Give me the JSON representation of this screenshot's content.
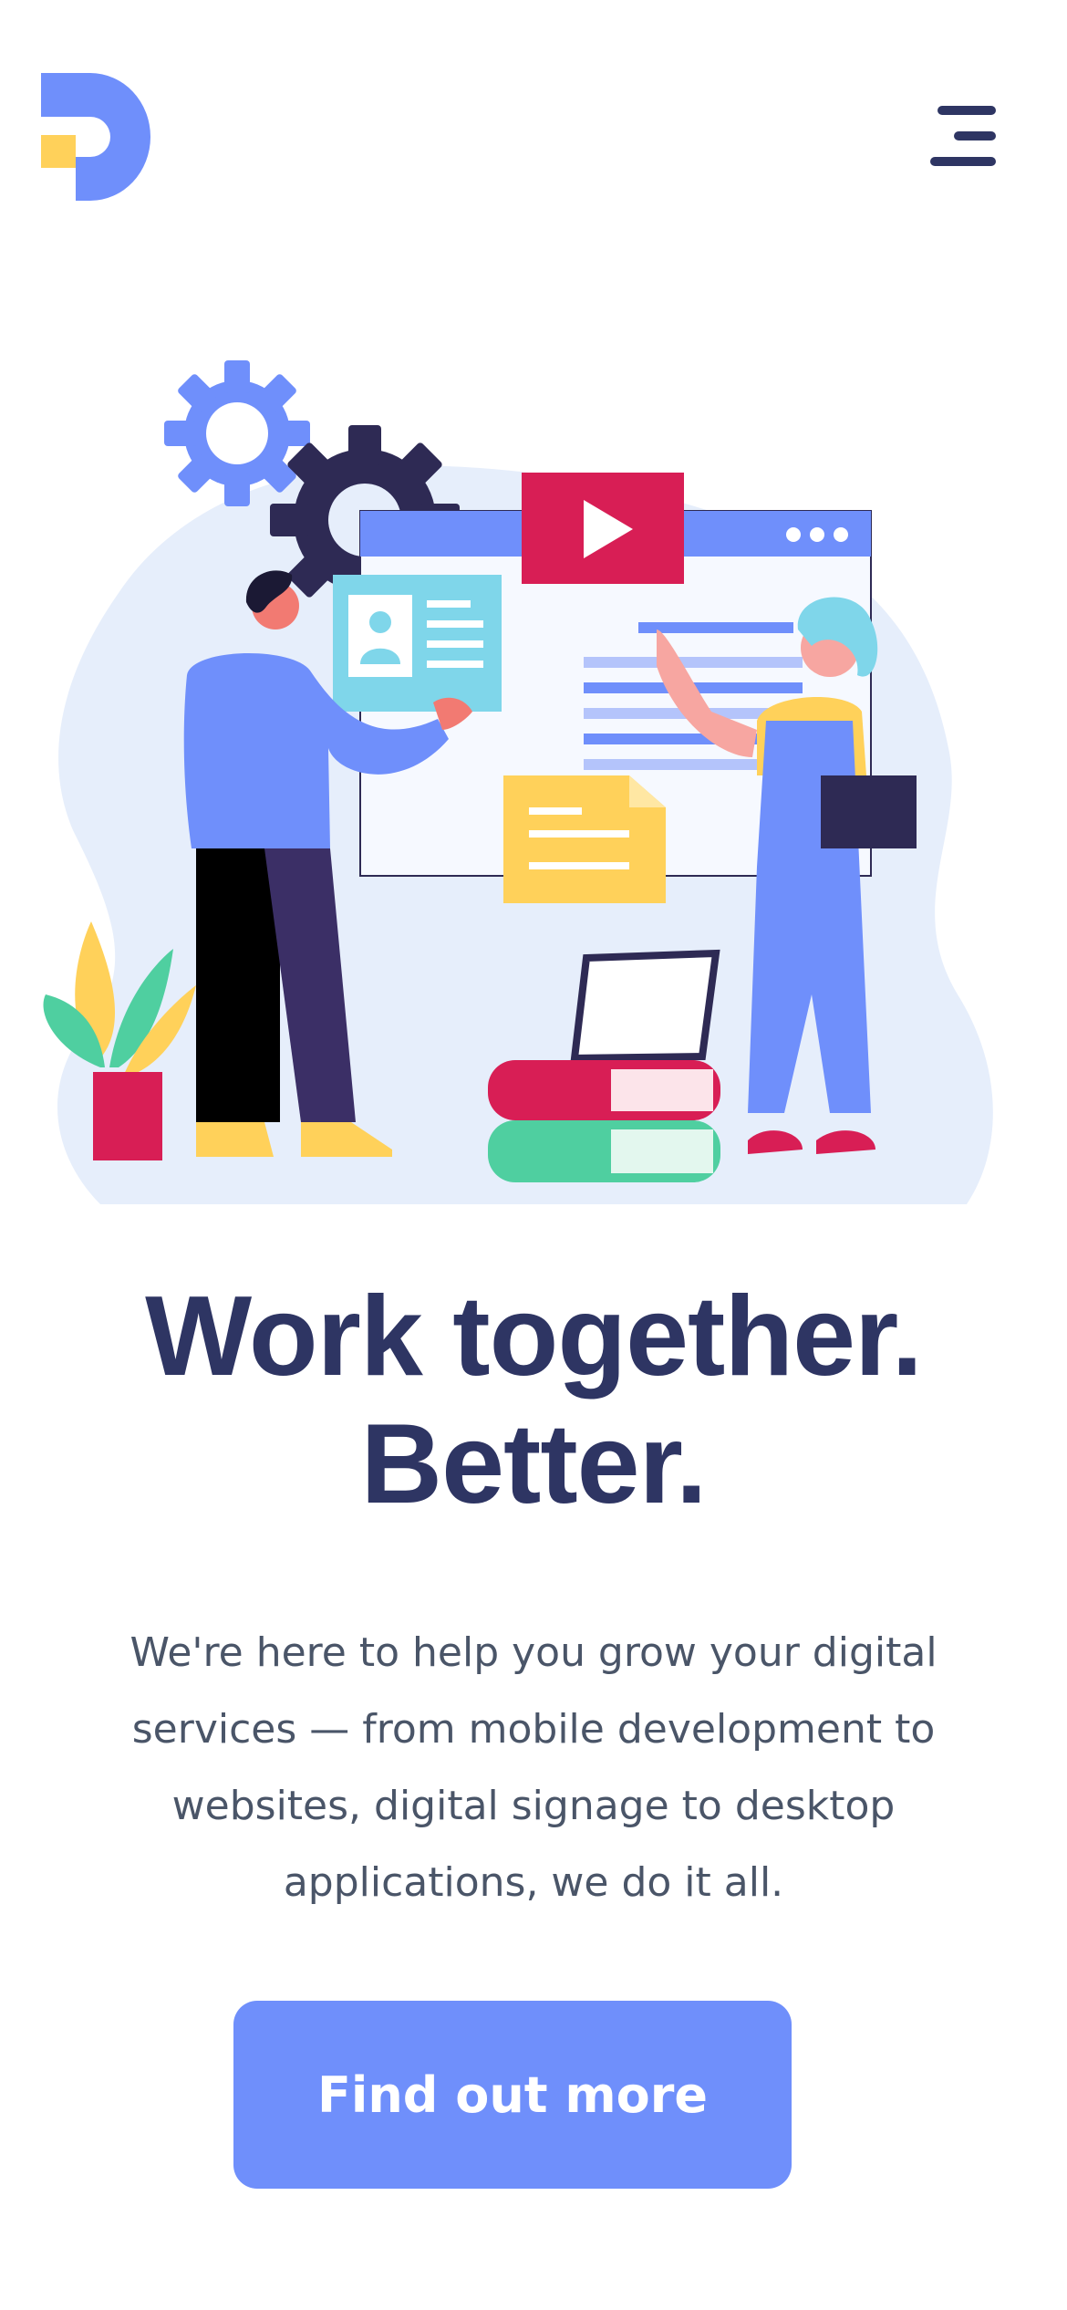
{
  "brand": {
    "logo_icon": "d-logo-icon",
    "colors": {
      "primary": "#6f8ffb",
      "accent_yellow": "#ffd15a",
      "heading": "#2e3563",
      "body_text": "#4a5568"
    }
  },
  "header": {
    "menu_icon": "hamburger-menu-icon"
  },
  "hero": {
    "illustration": "team-collaboration-illustration",
    "title_line1": "Work together.",
    "title_line2": "Better.",
    "description": "We're here to help you grow your digital services — from mobile development to websites, digital signage to desktop applications, we do it all.",
    "cta_label": "Find out more"
  }
}
